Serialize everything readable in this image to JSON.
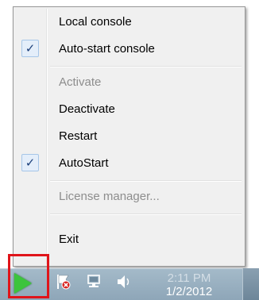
{
  "menu": {
    "items": [
      {
        "label": "Local console",
        "checked": false,
        "disabled": false
      },
      {
        "label": "Auto-start console",
        "checked": true,
        "disabled": false
      },
      {
        "label": "Activate",
        "checked": false,
        "disabled": true
      },
      {
        "label": "Deactivate",
        "checked": false,
        "disabled": false
      },
      {
        "label": "Restart",
        "checked": false,
        "disabled": false
      },
      {
        "label": "AutoStart",
        "checked": true,
        "disabled": false
      },
      {
        "label": "License manager...",
        "checked": false,
        "disabled": true
      },
      {
        "label": "Exit",
        "checked": false,
        "disabled": false
      }
    ],
    "check_glyph": "✓"
  },
  "taskbar": {
    "clock_time": "2:11 PM",
    "clock_date": "1/2/2012",
    "tray_icons": [
      "flag-error-icon",
      "network-icon",
      "speaker-icon"
    ],
    "start_icon": "play-icon",
    "highlight_color": "#e0141a"
  }
}
